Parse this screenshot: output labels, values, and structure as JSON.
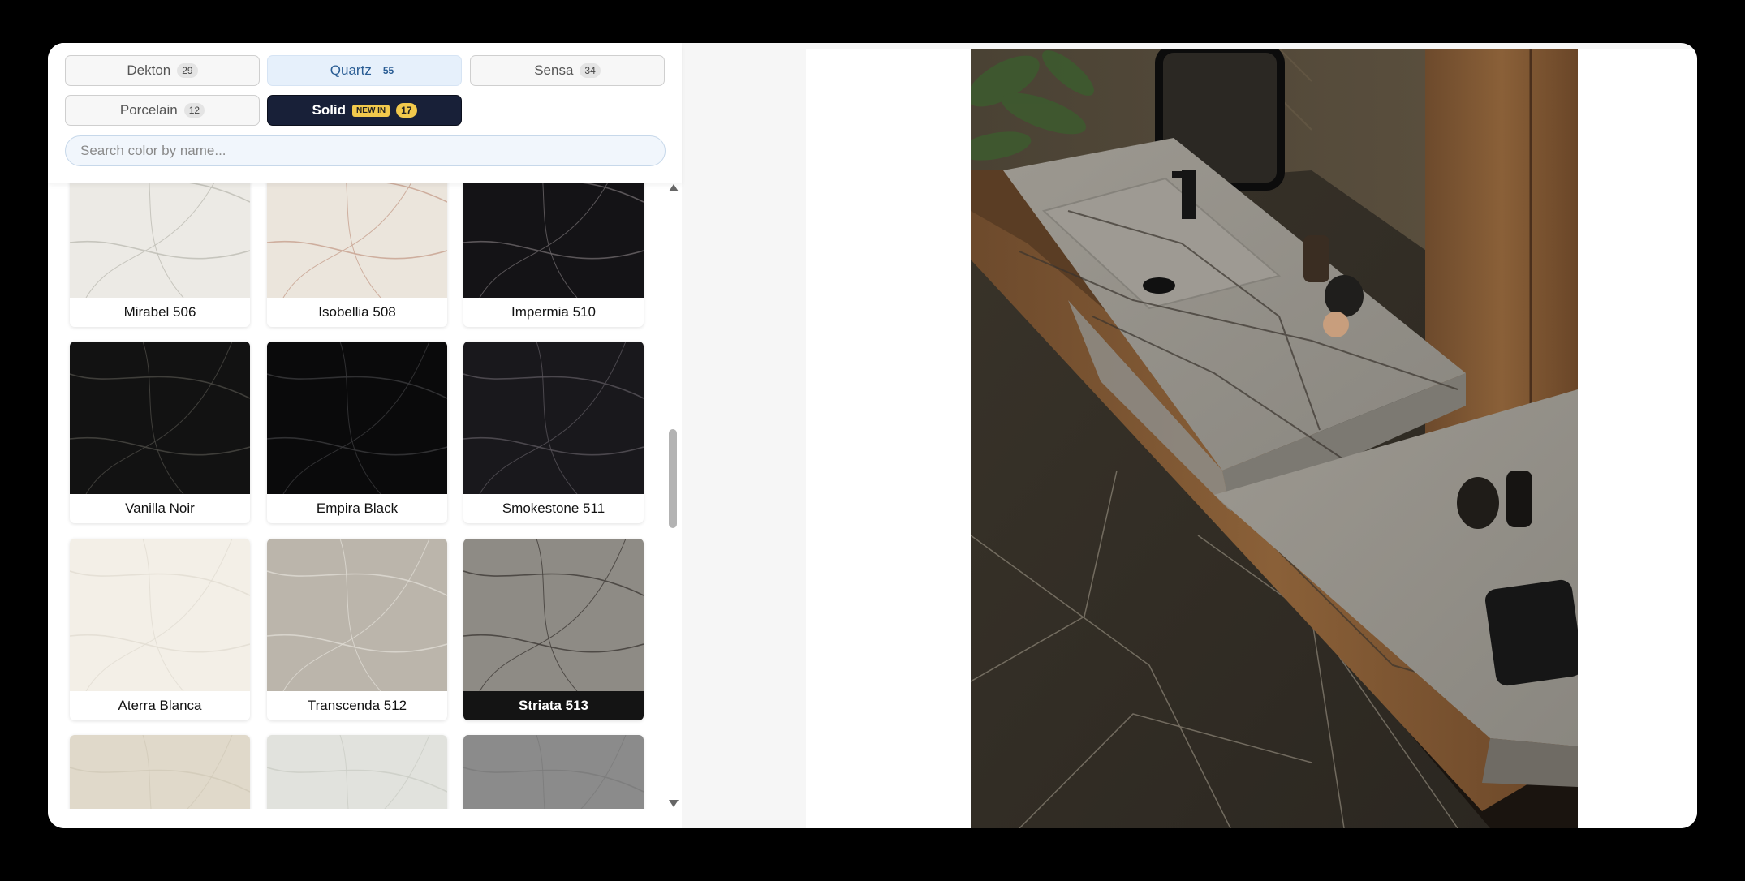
{
  "tabs": [
    {
      "label": "Dekton",
      "count": "29",
      "state": "default"
    },
    {
      "label": "Quartz",
      "count": "55",
      "state": "active"
    },
    {
      "label": "Sensa",
      "count": "34",
      "state": "default"
    },
    {
      "label": "Porcelain",
      "count": "12",
      "state": "default"
    },
    {
      "label": "Solid",
      "badge": "NEW IN",
      "count": "17",
      "state": "dark"
    }
  ],
  "search": {
    "placeholder": "Search color by name..."
  },
  "colors": [
    {
      "name": "Mirabel 506",
      "base": "#eceae5",
      "vein": "#bdbbb3"
    },
    {
      "name": "Isobellia 508",
      "base": "#ebe5dc",
      "vein": "#c7a08e"
    },
    {
      "name": "Impermia 510",
      "base": "#141316",
      "vein": "#6c6769"
    },
    {
      "name": "Vanilla Noir",
      "base": "#121212",
      "vein": "#4b4a45"
    },
    {
      "name": "Empira Black",
      "base": "#0a0a0b",
      "vein": "#3a3a3c"
    },
    {
      "name": "Smokestone 511",
      "base": "#19181c",
      "vein": "#57545a"
    },
    {
      "name": "Aterra Blanca",
      "base": "#f3efe7",
      "vein": "#e1dcd2"
    },
    {
      "name": "Transcenda 512",
      "base": "#bbb5ab",
      "vein": "#e0dcd5"
    },
    {
      "name": "Striata 513",
      "base": "#8e8b85",
      "vein": "#3e3a36",
      "selected": true
    },
    {
      "name": "",
      "base": "#e0d9ca",
      "vein": "#d1c9b8"
    },
    {
      "name": "",
      "base": "#e1e2dd",
      "vein": "#cbcdc6"
    },
    {
      "name": "",
      "base": "#8b8b8b",
      "vein": "#7a7a7a"
    }
  ]
}
